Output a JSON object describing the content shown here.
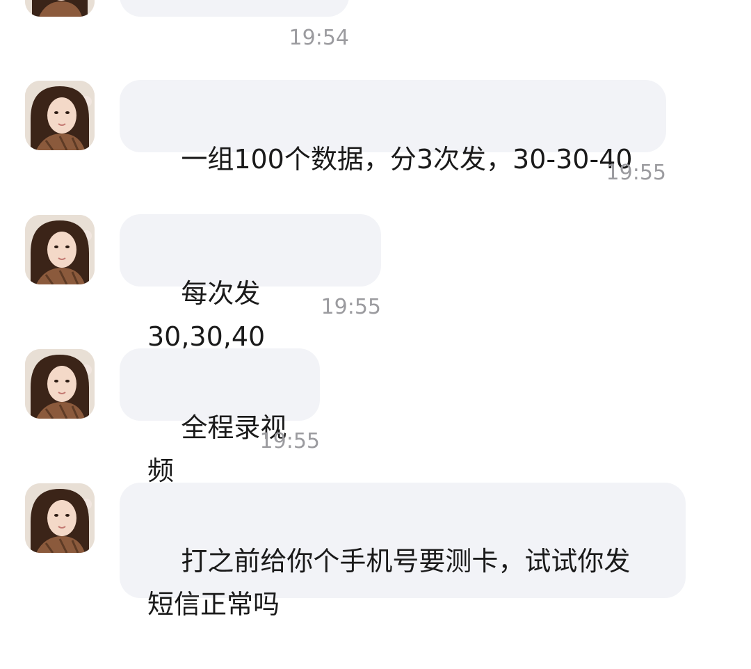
{
  "messages": [
    {
      "text": "",
      "time": "19:54"
    },
    {
      "text": "一组100个数据，分3次发，30-30-40",
      "time": "19:55"
    },
    {
      "text": "每次发30,30,40",
      "time": "19:55"
    },
    {
      "text": "全程录视频",
      "time": "19:55"
    },
    {
      "text": "打之前给你个手机号要测卡，试试你发\n短信正常吗",
      "time": ""
    }
  ],
  "colors": {
    "bubble_background": "#f2f3f7",
    "message_text": "#1a1a1a",
    "timestamp_text": "#9b9b9f",
    "page_background": "#ffffff"
  },
  "icons": {
    "avatar": "contact-avatar-photo"
  }
}
